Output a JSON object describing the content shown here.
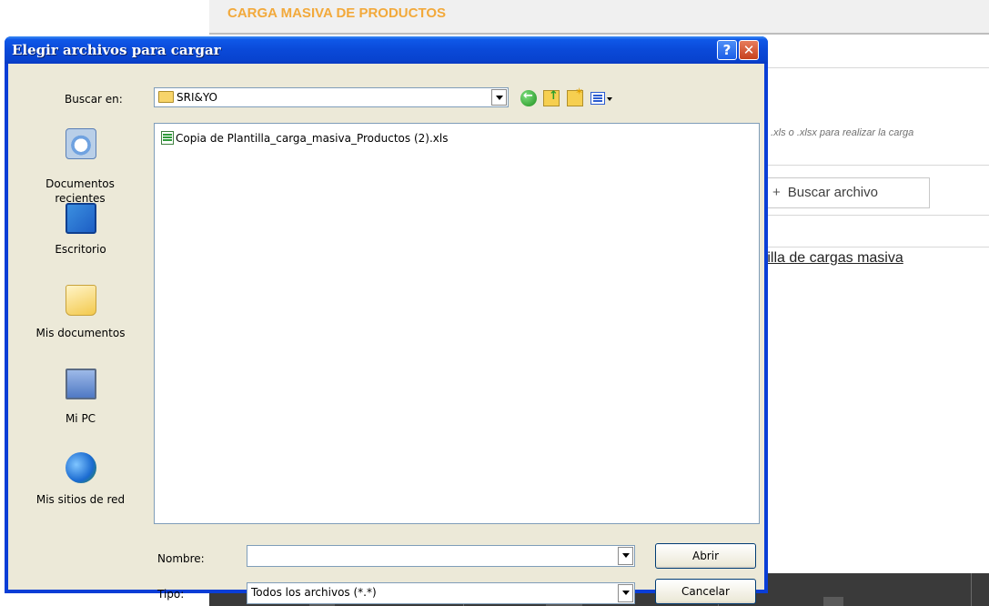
{
  "page": {
    "title": "CARGA MASIVA DE PRODUCTOS",
    "hint_text": "ivo .xls o .xlsx para realizar la carga",
    "browse_button_label": "Buscar archivo",
    "template_link_text": "ntilla de cargas masiva"
  },
  "dialog": {
    "title": "Elegir archivos para cargar",
    "help_button": "?",
    "close_button": "✕",
    "look_in_label": "Buscar en:",
    "look_in_value": "SRI&YO",
    "places": [
      {
        "label": "Documentos recientes",
        "icon": "recent-documents-icon"
      },
      {
        "label": "Escritorio",
        "icon": "desktop-icon"
      },
      {
        "label": "Mis documentos",
        "icon": "my-documents-icon"
      },
      {
        "label": "Mi PC",
        "icon": "my-computer-icon"
      },
      {
        "label": "Mis sitios de red",
        "icon": "network-places-icon"
      }
    ],
    "files": [
      {
        "name": "Copia de Plantilla_carga_masiva_Productos (2).xls",
        "icon": "excel-file-icon"
      }
    ],
    "filename_label": "Nombre:",
    "filename_value": "",
    "filetype_label": "Tipo:",
    "filetype_value": "Todos los archivos (*.*)",
    "open_button": "Abrir",
    "cancel_button": "Cancelar"
  },
  "colors": {
    "title_orange": "#f2a93b",
    "xp_titlebar_blue": "#0a49d8",
    "dialog_face": "#ece9d8",
    "close_red": "#c6411d"
  }
}
